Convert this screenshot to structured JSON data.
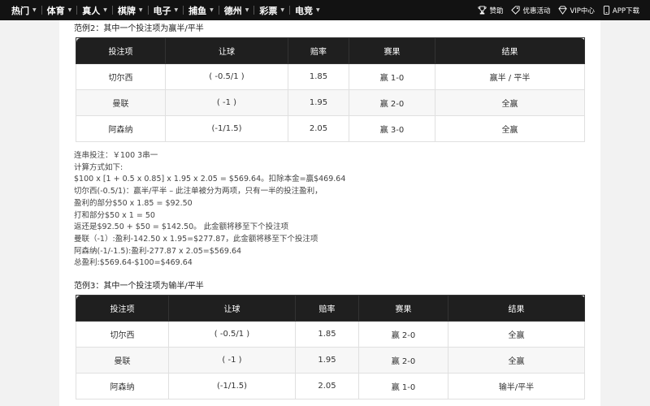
{
  "nav": {
    "items": [
      {
        "label": "热门",
        "caret": "▼"
      },
      {
        "label": "体育",
        "caret": "▼"
      },
      {
        "label": "真人",
        "caret": "▼"
      },
      {
        "label": "棋牌",
        "caret": "▼"
      },
      {
        "label": "电子",
        "caret": "▼"
      },
      {
        "label": "捕鱼",
        "caret": "▼"
      },
      {
        "label": "德州",
        "caret": "▼"
      },
      {
        "label": "彩票",
        "caret": "▼"
      },
      {
        "label": "电竞",
        "caret": "▼"
      }
    ],
    "links": [
      {
        "label": "赞助",
        "icon": "trophy-icon"
      },
      {
        "label": "优惠活动",
        "icon": "tag-icon"
      },
      {
        "label": "VIP中心",
        "icon": "diamond-icon"
      },
      {
        "label": "APP下载",
        "icon": "phone-icon"
      }
    ]
  },
  "example2": {
    "title": "范例2：其中一个投注项为赢半/平半",
    "headers": [
      "投注项",
      "让球",
      "赔率",
      "赛果",
      "结果"
    ],
    "rows": [
      [
        "切尔西",
        "( -0.5/1 )",
        "1.85",
        "赢 1-0",
        "赢半 / 平半"
      ],
      [
        "曼联",
        "( -1 )",
        "1.95",
        "赢 2-0",
        "全赢"
      ],
      [
        "阿森纳",
        "(-1/1.5)",
        "2.05",
        "赢 3-0",
        "全赢"
      ]
    ]
  },
  "calc_lines": [
    "连串投注：￥100 3串一",
    "计算方式如下:",
    "$100 x [1 + 0.5 x 0.85] x 1.95 x 2.05 = $569.64。扣除本金=赢$469.64",
    "切尔西(-0.5/1)：赢半/平半 – 此注单被分为两项，只有一半的投注盈利，",
    "盈利的部分$50 x 1.85 = $92.50",
    "打和部分$50 x 1 = 50",
    "返还是$92.50 + $50 = $142.50。 此金额将移至下个投注项",
    "曼联（-1）:盈利-142.50 x 1.95=$277.87，此金额将移至下个投注项",
    "阿森纳(-1/-1.5):盈利-277.87 x 2.05=$569.64",
    "总盈利:$569.64-$100=$469.64"
  ],
  "example3": {
    "title": "范例3：其中一个投注项为输半/平半",
    "headers": [
      "投注项",
      "让球",
      "赔率",
      "赛果",
      "结果"
    ],
    "rows": [
      [
        "切尔西",
        "( -0.5/1 )",
        "1.85",
        "赢 2-0",
        "全赢"
      ],
      [
        "曼联",
        "( -1 )",
        "1.95",
        "赢 2-0",
        "全赢"
      ],
      [
        "阿森纳",
        "(-1/1.5)",
        "2.05",
        "赢 1-0",
        "输半/平半"
      ]
    ]
  }
}
